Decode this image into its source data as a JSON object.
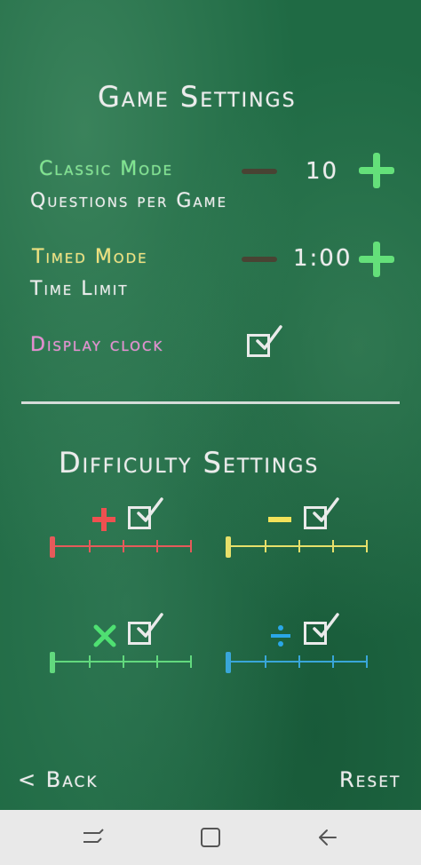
{
  "game_settings": {
    "title": "Game Settings",
    "classic": {
      "mode_label": "Classic Mode",
      "value": "10",
      "sub_label": "Questions per Game"
    },
    "timed": {
      "mode_label": "Timed Mode",
      "value": "1:00",
      "sub_label": "Time Limit"
    },
    "display_clock": {
      "label": "Display clock",
      "checked": true
    }
  },
  "difficulty_settings": {
    "title": "Difficulty Settings",
    "operations": [
      {
        "op": "+",
        "enabled": true,
        "level": 0
      },
      {
        "op": "−",
        "enabled": true,
        "level": 0
      },
      {
        "op": "×",
        "enabled": true,
        "level": 0
      },
      {
        "op": "÷",
        "enabled": true,
        "level": 0
      }
    ]
  },
  "footer": {
    "back_label": "< Back",
    "reset_label": "Reset"
  },
  "colors": {
    "classic": "#7ee68e",
    "timed": "#f0e27a",
    "display_clock": "#e98ad3",
    "plus": "#f05050",
    "minus": "#f3e25a",
    "times": "#4fe072",
    "divide": "#2aa7e8",
    "slider_plus": "#e65a5a",
    "slider_minus": "#e7e06a",
    "slider_times": "#62d97e",
    "slider_divide": "#39a6d9"
  },
  "navigation_bar": {
    "icons": [
      "recent-apps-icon",
      "home-icon",
      "back-arrow-icon"
    ]
  }
}
